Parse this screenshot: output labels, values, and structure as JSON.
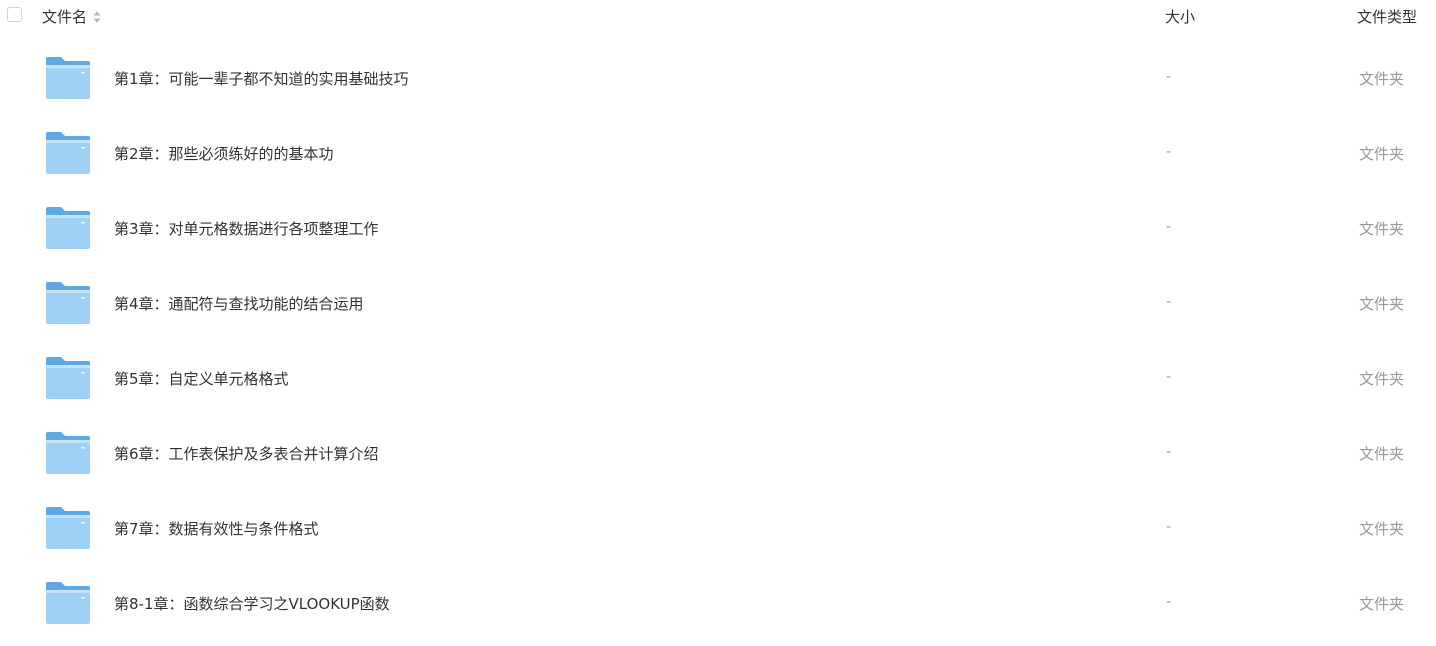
{
  "header": {
    "name_label": "文件名",
    "size_label": "大小",
    "type_label": "文件类型"
  },
  "colors": {
    "folder_light": "#9fd0f5",
    "folder_dark": "#5ea8e6",
    "muted_text": "#999999",
    "main_text": "#333333"
  },
  "files": [
    {
      "name": "第1章：可能一辈子都不知道的实用基础技巧",
      "size": "-",
      "type": "文件夹",
      "icon": "folder-icon"
    },
    {
      "name": "第2章：那些必须练好的的基本功",
      "size": "-",
      "type": "文件夹",
      "icon": "folder-icon"
    },
    {
      "name": "第3章：对单元格数据进行各项整理工作",
      "size": "-",
      "type": "文件夹",
      "icon": "folder-icon"
    },
    {
      "name": "第4章：通配符与查找功能的结合运用",
      "size": "-",
      "type": "文件夹",
      "icon": "folder-icon"
    },
    {
      "name": "第5章：自定义单元格格式",
      "size": "-",
      "type": "文件夹",
      "icon": "folder-icon"
    },
    {
      "name": "第6章：工作表保护及多表合并计算介绍",
      "size": "-",
      "type": "文件夹",
      "icon": "folder-icon"
    },
    {
      "name": "第7章：数据有效性与条件格式",
      "size": "-",
      "type": "文件夹",
      "icon": "folder-icon"
    },
    {
      "name": "第8-1章：函数综合学习之VLOOKUP函数",
      "size": "-",
      "type": "文件夹",
      "icon": "folder-icon"
    }
  ]
}
